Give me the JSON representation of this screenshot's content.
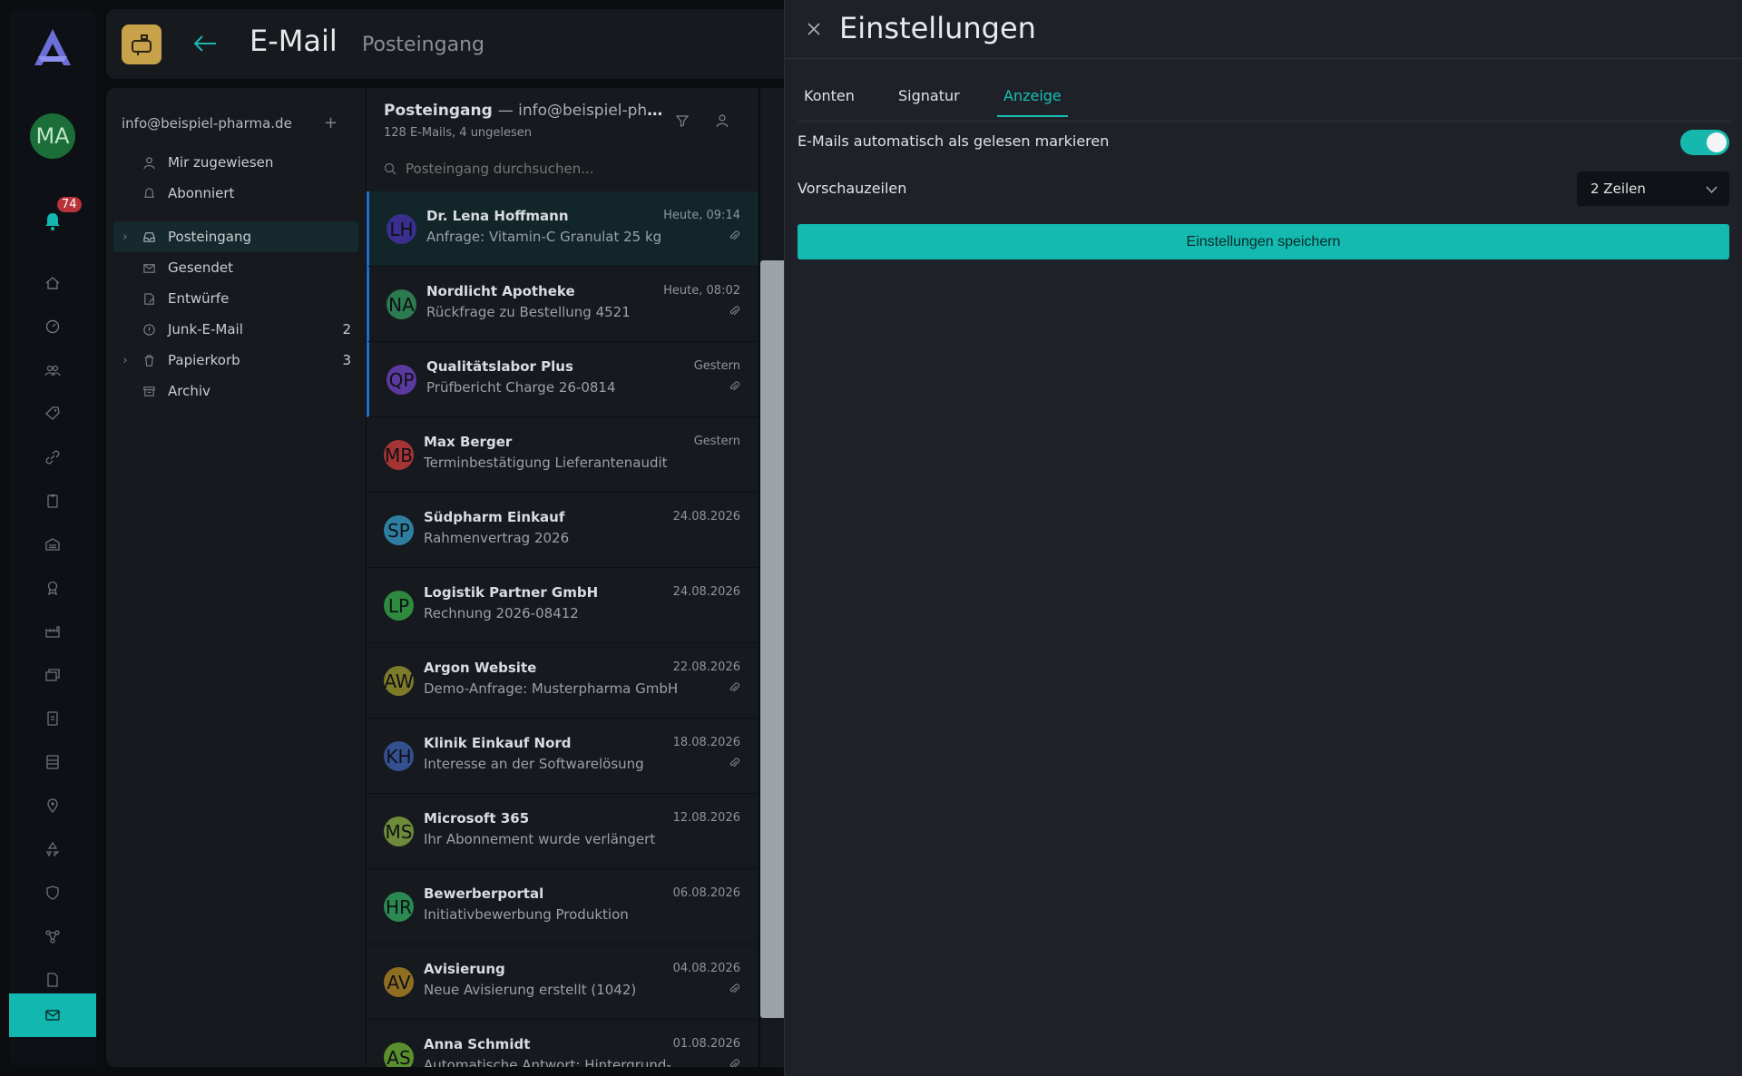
{
  "rail": {
    "avatar_initials": "MA",
    "notification_count": "74",
    "accent": "#12b8b0"
  },
  "header": {
    "title": "E-Mail",
    "subtitle": "Posteingang"
  },
  "folders": {
    "account": "info@beispiel-pharma.de",
    "items": [
      {
        "label": "Mir zugewiesen",
        "icon": "person-icon",
        "count": ""
      },
      {
        "label": "Abonniert",
        "icon": "bell-icon",
        "count": ""
      },
      {
        "label": "Posteingang",
        "icon": "inbox-icon",
        "count": "",
        "selected": true
      },
      {
        "label": "Gesendet",
        "icon": "envelope-icon",
        "count": ""
      },
      {
        "label": "Entwürfe",
        "icon": "draft-icon",
        "count": ""
      },
      {
        "label": "Junk-E-Mail",
        "icon": "warning-icon",
        "count": "2"
      },
      {
        "label": "Papierkorb",
        "icon": "trash-icon",
        "count": "3"
      },
      {
        "label": "Archiv",
        "icon": "archive-icon",
        "count": ""
      }
    ]
  },
  "list": {
    "title": "Posteingang",
    "title_account": "— info@beispiel-phar...",
    "count": "128 E-Mails, 4 ungelesen",
    "search_placeholder": "Posteingang durchsuchen...",
    "mails": [
      {
        "initials": "LH",
        "color": "#3a2f8f",
        "sender": "Dr. Lena Hoffmann",
        "subject": "Anfrage: Vitamin-C Granulat 25 kg",
        "date": "Heute, 09:14",
        "attachment": true
      },
      {
        "initials": "NA",
        "color": "#2c7a4f",
        "sender": "Nordlicht Apotheke",
        "subject": "Rückfrage zu Bestellung 4521",
        "date": "Heute, 08:02",
        "attachment": true
      },
      {
        "initials": "QP",
        "color": "#5b3aa0",
        "sender": "Qualitätslabor Plus",
        "subject": "Prüfbericht Charge 26-0814",
        "date": "Gestern",
        "attachment": true
      },
      {
        "initials": "MB",
        "color": "#a53434",
        "sender": "Max Berger",
        "subject": "Terminbestätigung Lieferantenaudit",
        "date": "Gestern",
        "attachment": false
      },
      {
        "initials": "SP",
        "color": "#2f7ea0",
        "sender": "Südpharm Einkauf",
        "subject": "Rahmenvertrag 2026",
        "date": "24.08.2026",
        "attachment": false
      },
      {
        "initials": "LP",
        "color": "#2d8a3f",
        "sender": "Logistik Partner GmbH",
        "subject": "Rechnung 2026-08412",
        "date": "24.08.2026",
        "attachment": false
      },
      {
        "initials": "AW",
        "color": "#7d7a2a",
        "sender": "Argon Website",
        "subject": "Demo-Anfrage: Musterpharma GmbH",
        "date": "22.08.2026",
        "attachment": true
      },
      {
        "initials": "KH",
        "color": "#34508f",
        "sender": "Klinik Einkauf Nord",
        "subject": "Interesse an der Softwarelösung",
        "date": "18.08.2026",
        "attachment": true
      },
      {
        "initials": "MS",
        "color": "#6f8a3a",
        "sender": "Microsoft 365",
        "subject": "Ihr Abonnement wurde verlängert",
        "date": "12.08.2026",
        "attachment": false
      },
      {
        "initials": "HR",
        "color": "#2a8a52",
        "sender": "Bewerberportal",
        "subject": "Initiativbewerbung Produktion",
        "date": "06.08.2026",
        "attachment": false
      },
      {
        "initials": "AV",
        "color": "#8f6e22",
        "sender": "Avisierung",
        "subject": "Neue Avisierung erstellt (1042)",
        "date": "04.08.2026",
        "attachment": true
      },
      {
        "initials": "AS",
        "color": "#5a8f2e",
        "sender": "Anna Schmidt",
        "subject": "Automatische Antwort: Hintergrund-",
        "date": "01.08.2026",
        "attachment": true
      }
    ]
  },
  "settings": {
    "title": "Einstellungen",
    "tabs": [
      "Konten",
      "Signatur",
      "Anzeige"
    ],
    "active_tab": "Anzeige",
    "auto_read_label": "E-Mails automatisch als gelesen markieren",
    "auto_read_on": true,
    "preview_lines_label": "Vorschauzeilen",
    "preview_lines_value": "2 Zeilen",
    "save_label": "Einstellungen speichern"
  }
}
